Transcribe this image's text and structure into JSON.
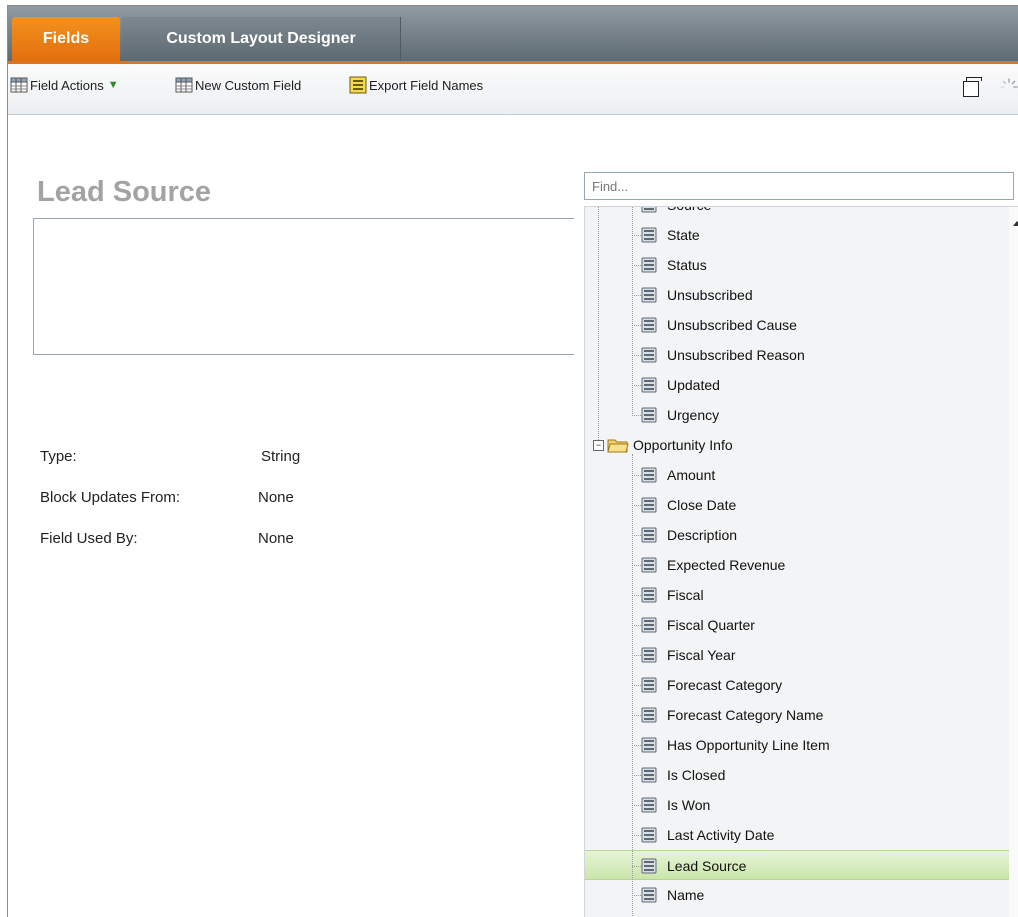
{
  "tabs": [
    {
      "label": "Fields",
      "active": true
    },
    {
      "label": "Custom Layout Designer",
      "active": false
    }
  ],
  "toolbar": {
    "field_actions_label": "Field Actions",
    "new_custom_field_label": "New Custom Field",
    "export_field_names_label": "Export Field Names",
    "icons": [
      "table-icon",
      "table-icon",
      "spreadsheet-icon",
      "window-icon",
      "spinner-icon"
    ]
  },
  "detail": {
    "title": "Lead Source",
    "properties": [
      {
        "label": "Type:",
        "value": "String"
      },
      {
        "label": "Block Updates From:",
        "value": "None"
      },
      {
        "label": "Field Used By:",
        "value": "None"
      }
    ]
  },
  "find": {
    "placeholder": "Find...",
    "value": ""
  },
  "tree": {
    "partial_top_label": "Source",
    "items_before": [
      "State",
      "Status",
      "Unsubscribed",
      "Unsubscribed Cause",
      "Unsubscribed Reason",
      "Updated",
      "Urgency"
    ],
    "folder": {
      "label": "Opportunity Info",
      "expanded": true
    },
    "folder_items": [
      "Amount",
      "Close Date",
      "Description",
      "Expected Revenue",
      "Fiscal",
      "Fiscal Quarter",
      "Fiscal Year",
      "Forecast Category",
      "Forecast Category Name",
      "Has Opportunity Line Item",
      "Is Closed",
      "Is Won",
      "Last Activity Date",
      "Lead Source",
      "Name"
    ],
    "selected": "Lead Source"
  },
  "colors": {
    "accent": "#e26f0d",
    "tabbar": "#6b767d",
    "selection": "#cbe6aa"
  }
}
